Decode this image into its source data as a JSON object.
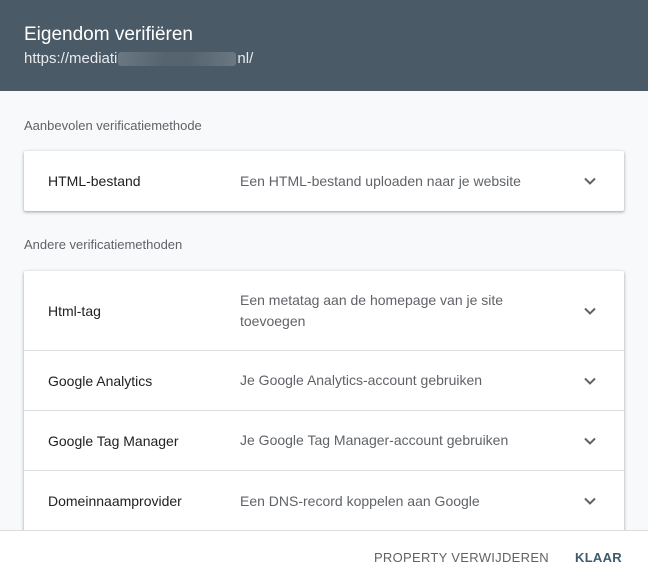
{
  "header": {
    "title": "Eigendom verifiëren",
    "url_prefix": "https://mediati",
    "url_suffix": "nl/"
  },
  "recommended": {
    "label": "Aanbevolen verificatiemethode",
    "items": [
      {
        "name": "HTML-bestand",
        "description": "Een HTML-bestand uploaden naar je website"
      }
    ]
  },
  "other": {
    "label": "Andere verificatiemethoden",
    "items": [
      {
        "name": "Html-tag",
        "description": "Een metatag aan de homepage van je site toevoegen"
      },
      {
        "name": "Google Analytics",
        "description": "Je Google Analytics-account gebruiken"
      },
      {
        "name": "Google Tag Manager",
        "description": "Je Google Tag Manager-account gebruiken"
      },
      {
        "name": "Domeinnaamprovider",
        "description": "Een DNS-record koppelen aan Google"
      }
    ]
  },
  "footer": {
    "remove_label": "PROPERTY VERWIJDEREN",
    "done_label": "KLAAR"
  },
  "icons": {
    "row_expand": "chevron-down-icon"
  },
  "colors": {
    "header_bg": "#4a5a66",
    "primary_button": "#3f5a6b"
  }
}
